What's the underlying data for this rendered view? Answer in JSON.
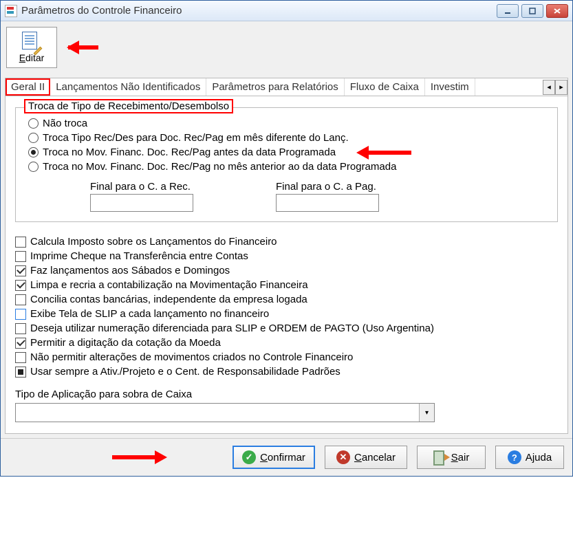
{
  "window": {
    "title": "Parâmetros do Controle Financeiro"
  },
  "toolbar": {
    "edit_label": "Editar"
  },
  "tabs": {
    "items": [
      "Geral II",
      "Lançamentos Não Identificados",
      "Parâmetros para Relatórios",
      "Fluxo de Caixa",
      "Investim"
    ],
    "active_index": 0
  },
  "troca": {
    "legend": "Troca de Tipo de Recebimento/Desembolso",
    "options": [
      "Não troca",
      "Troca Tipo Rec/Des para Doc. Rec/Pag em mês diferente do Lanç.",
      "Troca no Mov. Financ. Doc. Rec/Pag antes da data Programada",
      "Troca no Mov. Financ. Doc. Rec/Pag no mês anterior ao da data Programada"
    ],
    "selected_index": 2,
    "final_rec_label": "Final para o C. a Rec.",
    "final_pag_label": "Final para o C. a Pag.",
    "final_rec_value": "",
    "final_pag_value": ""
  },
  "checks": [
    {
      "label": "Calcula Imposto sobre os Lançamentos do Financeiro",
      "state": "unchecked"
    },
    {
      "label": "Imprime Cheque na Transferência entre Contas",
      "state": "unchecked"
    },
    {
      "label": "Faz lançamentos aos Sábados e Domingos",
      "state": "checked"
    },
    {
      "label": "Limpa e recria a contabilização na Movimentação Financeira",
      "state": "checked"
    },
    {
      "label": "Concilia contas bancárias, independente da empresa logada",
      "state": "unchecked"
    },
    {
      "label": "Exibe Tela de SLIP a cada lançamento no financeiro",
      "state": "unchecked-blue"
    },
    {
      "label": "Deseja utilizar numeração diferenciada para SLIP e ORDEM de PAGTO (Uso Argentina)",
      "state": "unchecked"
    },
    {
      "label": "Permitir a digitação da cotação da Moeda",
      "state": "checked"
    },
    {
      "label": "Não permitir alterações de movimentos criados no Controle Financeiro",
      "state": "unchecked"
    },
    {
      "label": "Usar sempre a Ativ./Projeto e o Cent. de Responsabilidade Padrões",
      "state": "square"
    }
  ],
  "dropdown": {
    "label": "Tipo de Aplicação para sobra de Caixa",
    "value": ""
  },
  "footer": {
    "confirm": "Confirmar",
    "cancel": "Cancelar",
    "exit": "Sair",
    "help": "Ajuda"
  }
}
